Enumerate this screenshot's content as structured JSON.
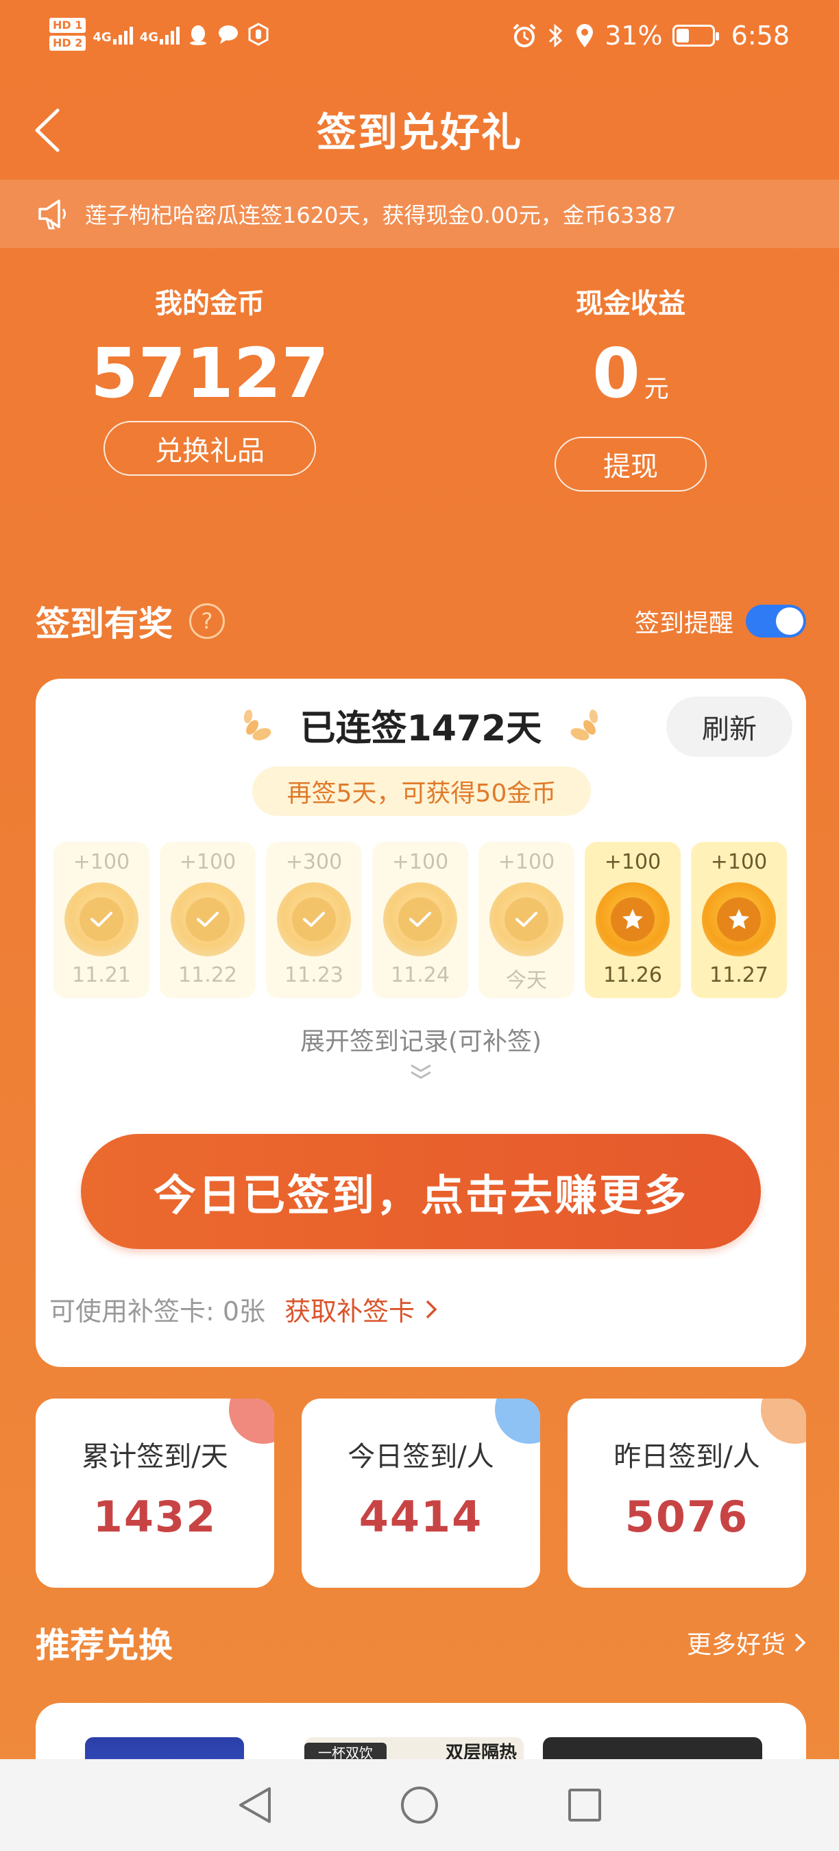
{
  "status_bar": {
    "hd1": "HD 1",
    "hd2": "HD 2",
    "net1": "4G",
    "net2": "4G",
    "battery": "31%",
    "time": "6:58"
  },
  "header": {
    "title": "签到兑好礼"
  },
  "notice": {
    "text": "莲子枸杞哈密瓜连签1620天，获得现金0.00元，金币63387"
  },
  "coins": {
    "title": "我的金币",
    "value": "57127",
    "button": "兑换礼品"
  },
  "cash": {
    "title": "现金收益",
    "value": "0",
    "unit": "元",
    "button": "提现"
  },
  "checkin_section": {
    "title": "签到有奖",
    "help": "?",
    "reminder_label": "签到提醒",
    "reminder_on": true
  },
  "checkin_card": {
    "streak": "已连签1472天",
    "refresh": "刷新",
    "tip": "再签5天，可获得50金币",
    "days": [
      {
        "points": "+100",
        "date": "11.21",
        "status": "done"
      },
      {
        "points": "+100",
        "date": "11.22",
        "status": "done"
      },
      {
        "points": "+300",
        "date": "11.23",
        "status": "done"
      },
      {
        "points": "+100",
        "date": "11.24",
        "status": "done"
      },
      {
        "points": "+100",
        "date": "今天",
        "status": "done"
      },
      {
        "points": "+100",
        "date": "11.26",
        "status": "upcoming"
      },
      {
        "points": "+100",
        "date": "11.27",
        "status": "upcoming"
      }
    ],
    "expand": "展开签到记录(可补签)",
    "main_button": "今日已签到，点击去赚更多",
    "makeup_label": "可使用补签卡:  0张",
    "makeup_link": "获取补签卡"
  },
  "stats": [
    {
      "label": "累计签到/天",
      "value": "1432",
      "color": "#F08A7E"
    },
    {
      "label": "今日签到/人",
      "value": "4414",
      "color": "#8EC2F5"
    },
    {
      "label": "昨日签到/人",
      "value": "5076",
      "color": "#F5B98A"
    }
  ],
  "recommend": {
    "title": "推荐兑换",
    "more": "更多好货",
    "product_tags": {
      "tag1": "一杯双饮",
      "tag2": "双层隔热"
    }
  },
  "colors": {
    "background": "#F17A33",
    "accent": "#E6592C",
    "toggle": "#2F7BF5",
    "value_red": "#C84444"
  }
}
